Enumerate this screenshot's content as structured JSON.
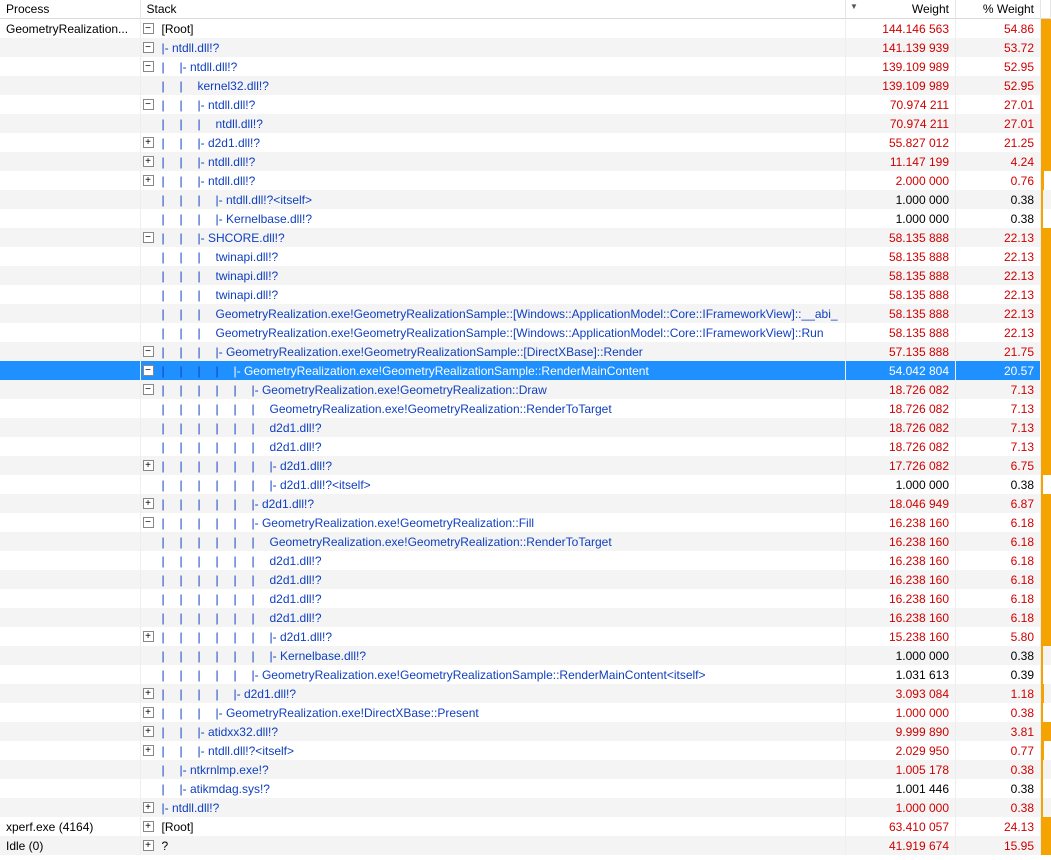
{
  "headers": {
    "process": "Process",
    "stack": "Stack",
    "weight": "Weight",
    "pct": "% Weight"
  },
  "rows": [
    {
      "proc": "GeometryRealization...",
      "depth": 0,
      "exp": "-",
      "pipes": 0,
      "prefix": "",
      "label": "[Root]",
      "black": true,
      "w": "144.146 563",
      "p": "54.86",
      "red": true,
      "bar": "full"
    },
    {
      "proc": "",
      "depth": 1,
      "exp": "-",
      "pipes": 0,
      "prefix": "|- ",
      "label": "ntdll.dll!?",
      "w": "141.139 939",
      "p": "53.72",
      "red": true,
      "bar": "full"
    },
    {
      "proc": "",
      "depth": 2,
      "exp": "-",
      "pipes": 1,
      "prefix": "|- ",
      "label": "ntdll.dll!?",
      "w": "139.109 989",
      "p": "52.95",
      "red": true,
      "bar": "full"
    },
    {
      "proc": "",
      "depth": 3,
      "exp": "",
      "pipes": 2,
      "prefix": "",
      "label": "kernel32.dll!?",
      "w": "139.109 989",
      "p": "52.95",
      "red": true,
      "bar": "full"
    },
    {
      "proc": "",
      "depth": 2,
      "exp": "-",
      "pipes": 2,
      "prefix": "|- ",
      "label": "ntdll.dll!?",
      "w": "70.974 211",
      "p": "27.01",
      "red": true,
      "bar": "full"
    },
    {
      "proc": "",
      "depth": 3,
      "exp": "",
      "pipes": 3,
      "prefix": "",
      "label": "ntdll.dll!?",
      "w": "70.974 211",
      "p": "27.01",
      "red": true,
      "bar": "full"
    },
    {
      "proc": "",
      "depth": 2,
      "exp": "+",
      "pipes": 2,
      "prefix": "|- ",
      "label": "d2d1.dll!?",
      "w": "55.827 012",
      "p": "21.25",
      "red": true,
      "bar": "full"
    },
    {
      "proc": "",
      "depth": 2,
      "exp": "+",
      "pipes": 2,
      "prefix": "|- ",
      "label": "ntdll.dll!?",
      "w": "11.147 199",
      "p": "4.24",
      "red": true,
      "bar": "full"
    },
    {
      "proc": "",
      "depth": 2,
      "exp": "+",
      "pipes": 2,
      "prefix": "|- ",
      "label": "ntdll.dll!?",
      "w": "2.000 000",
      "p": "0.76",
      "red": true,
      "bar": "small"
    },
    {
      "proc": "",
      "depth": 3,
      "exp": "",
      "pipes": 3,
      "prefix": "|- ",
      "label": "ntdll.dll!?<itself>",
      "w": "1.000 000",
      "p": "0.38",
      "red": false,
      "bar": "tiny"
    },
    {
      "proc": "",
      "depth": 3,
      "exp": "",
      "pipes": 3,
      "prefix": "|- ",
      "label": "Kernelbase.dll!?",
      "w": "1.000 000",
      "p": "0.38",
      "red": false,
      "bar": "tiny"
    },
    {
      "proc": "",
      "depth": 2,
      "exp": "-",
      "pipes": 2,
      "prefix": "|- ",
      "label": "SHCORE.dll!?",
      "w": "58.135 888",
      "p": "22.13",
      "red": true,
      "bar": "full"
    },
    {
      "proc": "",
      "depth": 3,
      "exp": "",
      "pipes": 3,
      "prefix": "",
      "label": "twinapi.dll!?",
      "w": "58.135 888",
      "p": "22.13",
      "red": true,
      "bar": "full"
    },
    {
      "proc": "",
      "depth": 3,
      "exp": "",
      "pipes": 3,
      "prefix": "",
      "label": "twinapi.dll!?",
      "w": "58.135 888",
      "p": "22.13",
      "red": true,
      "bar": "full"
    },
    {
      "proc": "",
      "depth": 3,
      "exp": "",
      "pipes": 3,
      "prefix": "",
      "label": "twinapi.dll!?",
      "w": "58.135 888",
      "p": "22.13",
      "red": true,
      "bar": "full"
    },
    {
      "proc": "",
      "depth": 3,
      "exp": "",
      "pipes": 3,
      "prefix": "",
      "label": "GeometryRealization.exe!GeometryRealizationSample::[Windows::ApplicationModel::Core::IFrameworkView]::__abi_",
      "w": "58.135 888",
      "p": "22.13",
      "red": true,
      "bar": "full"
    },
    {
      "proc": "",
      "depth": 3,
      "exp": "",
      "pipes": 3,
      "prefix": "",
      "label": "GeometryRealization.exe!GeometryRealizationSample::[Windows::ApplicationModel::Core::IFrameworkView]::Run",
      "w": "58.135 888",
      "p": "22.13",
      "red": true,
      "bar": "full"
    },
    {
      "proc": "",
      "depth": 2,
      "exp": "-",
      "pipes": 3,
      "prefix": "|- ",
      "label": "GeometryRealization.exe!GeometryRealizationSample::[DirectXBase]::Render",
      "w": "57.135 888",
      "p": "21.75",
      "red": true,
      "bar": "full"
    },
    {
      "proc": "",
      "depth": 2,
      "sel": true,
      "exp": "-",
      "pipes": 4,
      "prefix": "|- ",
      "label": "GeometryRealization.exe!GeometryRealizationSample::RenderMainContent",
      "w": "54.042 804",
      "p": "20.57",
      "red": true,
      "bar": "full"
    },
    {
      "proc": "",
      "depth": 3,
      "exp": "-",
      "pipes": 5,
      "prefix": "|- ",
      "label": "GeometryRealization.exe!GeometryRealization::Draw",
      "w": "18.726 082",
      "p": "7.13",
      "red": true,
      "bar": "full"
    },
    {
      "proc": "",
      "depth": 4,
      "exp": "",
      "pipes": 6,
      "prefix": "",
      "label": "GeometryRealization.exe!GeometryRealization::RenderToTarget",
      "w": "18.726 082",
      "p": "7.13",
      "red": true,
      "bar": "full"
    },
    {
      "proc": "",
      "depth": 4,
      "exp": "",
      "pipes": 6,
      "prefix": "",
      "label": "d2d1.dll!?",
      "w": "18.726 082",
      "p": "7.13",
      "red": true,
      "bar": "full"
    },
    {
      "proc": "",
      "depth": 4,
      "exp": "",
      "pipes": 6,
      "prefix": "",
      "label": "d2d1.dll!?",
      "w": "18.726 082",
      "p": "7.13",
      "red": true,
      "bar": "full"
    },
    {
      "proc": "",
      "depth": 3,
      "exp": "+",
      "pipes": 6,
      "prefix": "|- ",
      "label": "d2d1.dll!?",
      "w": "17.726 082",
      "p": "6.75",
      "red": true,
      "bar": "full"
    },
    {
      "proc": "",
      "depth": 4,
      "exp": "",
      "pipes": 6,
      "prefix": "|- ",
      "label": "d2d1.dll!?<itself>",
      "w": "1.000 000",
      "p": "0.38",
      "red": false,
      "bar": "tiny"
    },
    {
      "proc": "",
      "depth": 3,
      "exp": "+",
      "pipes": 5,
      "prefix": "|- ",
      "label": "d2d1.dll!?",
      "w": "18.046 949",
      "p": "6.87",
      "red": true,
      "bar": "full"
    },
    {
      "proc": "",
      "depth": 3,
      "exp": "-",
      "pipes": 5,
      "prefix": "|- ",
      "label": "GeometryRealization.exe!GeometryRealization::Fill",
      "w": "16.238 160",
      "p": "6.18",
      "red": true,
      "bar": "full"
    },
    {
      "proc": "",
      "depth": 4,
      "exp": "",
      "pipes": 6,
      "prefix": "",
      "label": "GeometryRealization.exe!GeometryRealization::RenderToTarget",
      "w": "16.238 160",
      "p": "6.18",
      "red": true,
      "bar": "full"
    },
    {
      "proc": "",
      "depth": 4,
      "exp": "",
      "pipes": 6,
      "prefix": "",
      "label": "d2d1.dll!?",
      "w": "16.238 160",
      "p": "6.18",
      "red": true,
      "bar": "full"
    },
    {
      "proc": "",
      "depth": 4,
      "exp": "",
      "pipes": 6,
      "prefix": "",
      "label": "d2d1.dll!?",
      "w": "16.238 160",
      "p": "6.18",
      "red": true,
      "bar": "full"
    },
    {
      "proc": "",
      "depth": 4,
      "exp": "",
      "pipes": 6,
      "prefix": "",
      "label": "d2d1.dll!?",
      "w": "16.238 160",
      "p": "6.18",
      "red": true,
      "bar": "full"
    },
    {
      "proc": "",
      "depth": 4,
      "exp": "",
      "pipes": 6,
      "prefix": "",
      "label": "d2d1.dll!?",
      "w": "16.238 160",
      "p": "6.18",
      "red": true,
      "bar": "full"
    },
    {
      "proc": "",
      "depth": 3,
      "exp": "+",
      "pipes": 6,
      "prefix": "|- ",
      "label": "d2d1.dll!?",
      "w": "15.238 160",
      "p": "5.80",
      "red": true,
      "bar": "full"
    },
    {
      "proc": "",
      "depth": 4,
      "exp": "",
      "pipes": 6,
      "prefix": "|- ",
      "label": "Kernelbase.dll!?",
      "w": "1.000 000",
      "p": "0.38",
      "red": false,
      "bar": "tiny"
    },
    {
      "proc": "",
      "depth": 4,
      "exp": "",
      "pipes": 5,
      "prefix": "|- ",
      "label": "GeometryRealization.exe!GeometryRealizationSample::RenderMainContent<itself>",
      "w": "1.031 613",
      "p": "0.39",
      "red": false,
      "bar": "tiny"
    },
    {
      "proc": "",
      "depth": 3,
      "exp": "+",
      "pipes": 4,
      "prefix": "|- ",
      "label": "d2d1.dll!?",
      "w": "3.093 084",
      "p": "1.18",
      "red": true,
      "bar": "small"
    },
    {
      "proc": "",
      "depth": 3,
      "exp": "+",
      "pipes": 3,
      "prefix": "|- ",
      "label": "GeometryRealization.exe!DirectXBase::Present",
      "w": "1.000 000",
      "p": "0.38",
      "red": true,
      "bar": "tiny"
    },
    {
      "proc": "",
      "depth": 2,
      "exp": "+",
      "pipes": 2,
      "prefix": "|- ",
      "label": "atidxx32.dll!?",
      "w": "9.999 890",
      "p": "3.81",
      "red": true,
      "bar": "full"
    },
    {
      "proc": "",
      "depth": 2,
      "exp": "+",
      "pipes": 2,
      "prefix": "|- ",
      "label": "ntdll.dll!?<itself>",
      "w": "2.029 950",
      "p": "0.77",
      "red": true,
      "bar": "small"
    },
    {
      "proc": "",
      "depth": 2,
      "exp": "",
      "pipes": 1,
      "prefix": "|- ",
      "label": "ntkrnlmp.exe!?",
      "w": "1.005 178",
      "p": "0.38",
      "red": true,
      "bar": "tiny"
    },
    {
      "proc": "",
      "depth": 2,
      "exp": "",
      "pipes": 1,
      "prefix": "|- ",
      "label": "atikmdag.sys!?",
      "w": "1.001 446",
      "p": "0.38",
      "red": false,
      "bar": "tiny"
    },
    {
      "proc": "",
      "depth": 1,
      "exp": "+",
      "pipes": 0,
      "prefix": "|- ",
      "label": "ntdll.dll!?",
      "w": "1.000 000",
      "p": "0.38",
      "red": true,
      "bar": "tiny"
    },
    {
      "proc": "xperf.exe (4164)",
      "depth": 0,
      "exp": "+",
      "pipes": 0,
      "prefix": "",
      "label": "[Root]",
      "black": true,
      "w": "63.410 057",
      "p": "24.13",
      "red": true,
      "bar": "full"
    },
    {
      "proc": "Idle (0)",
      "depth": 0,
      "exp": "+",
      "pipes": 0,
      "prefix": "",
      "label": "?",
      "black": true,
      "w": "41.919 674",
      "p": "15.95",
      "red": true,
      "bar": "full"
    }
  ]
}
